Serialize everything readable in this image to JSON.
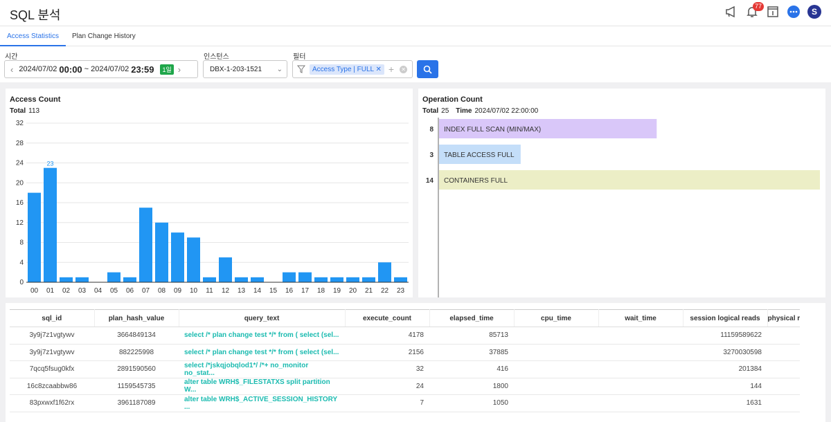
{
  "header": {
    "title": "SQL 분석",
    "notification_count": "77",
    "avatar_letter": "S",
    "icons": [
      "megaphone-icon",
      "bell-icon",
      "info-book-icon",
      "chat-icon",
      "avatar"
    ]
  },
  "tabs": [
    {
      "label": "Access Statistics",
      "active": true
    },
    {
      "label": "Plan Change History",
      "active": false
    }
  ],
  "filters": {
    "time_label": "시간",
    "start_date": "2024/07/02",
    "start_time": "00:00",
    "separator": "~",
    "end_date": "2024/07/02",
    "end_time": "23:59",
    "range_badge": "1일",
    "instance_label": "인스턴스",
    "instance_value": "DBX-1-203-1521",
    "filter_label": "필터",
    "filter_chip": "Access Type | FULL"
  },
  "access_panel": {
    "title": "Access Count",
    "total_label": "Total",
    "total_value": "113"
  },
  "operation_panel": {
    "title": "Operation Count",
    "total_label": "Total",
    "total_value": "25",
    "time_label": "Time",
    "time_value": "2024/07/02 22:00:00"
  },
  "chart_data": [
    {
      "type": "bar",
      "title": "Access Count",
      "categories": [
        "00",
        "01",
        "02",
        "03",
        "04",
        "05",
        "06",
        "07",
        "08",
        "09",
        "10",
        "11",
        "12",
        "13",
        "14",
        "15",
        "16",
        "17",
        "18",
        "19",
        "20",
        "21",
        "22",
        "23"
      ],
      "values": [
        18,
        23,
        1,
        1,
        0,
        2,
        1,
        15,
        12,
        10,
        9,
        1,
        5,
        1,
        1,
        0,
        2,
        2,
        1,
        1,
        1,
        1,
        4,
        1
      ],
      "ylim": [
        0,
        32
      ],
      "yticks": [
        0,
        4,
        8,
        12,
        16,
        20,
        24,
        28,
        32
      ],
      "highlight_label": {
        "category": "01",
        "value": "23"
      },
      "color": "#2196f3",
      "grid": true
    },
    {
      "type": "bar",
      "orientation": "horizontal",
      "title": "Operation Count",
      "categories": [
        "INDEX FULL SCAN (MIN/MAX)",
        "TABLE ACCESS FULL",
        "CONTAINERS FULL"
      ],
      "values": [
        8,
        3,
        14
      ],
      "colors": [
        "#d9c7f9",
        "#c4def9",
        "#eceec6"
      ]
    }
  ],
  "table": {
    "columns": [
      "sql_id",
      "plan_hash_value",
      "query_text",
      "execute_count",
      "elapsed_time",
      "cpu_time",
      "wait_time",
      "session logical reads",
      "physical r"
    ],
    "rows": [
      [
        "3y9j7z1vgtywv",
        "3664849134",
        "select /* plan change test */* from ( select (sel...",
        "4178",
        "85713",
        "",
        "",
        "11159589622",
        ""
      ],
      [
        "3y9j7z1vgtywv",
        "882225998",
        "select /* plan change test */* from ( select (sel...",
        "2156",
        "37885",
        "",
        "",
        "3270030598",
        ""
      ],
      [
        "7qcq5fsug0kfx",
        "2891590560",
        "select /*jskqjobqlod1*/ /*+ no_monitor no_stat...",
        "32",
        "416",
        "",
        "",
        "201384",
        ""
      ],
      [
        "16c8zcaabbw86",
        "1159545735",
        "alter table WRH$_FILESTATXS split partition W...",
        "24",
        "1800",
        "",
        "",
        "144",
        ""
      ],
      [
        "83pxwxf1f62rx",
        "3961187089",
        "alter table WRH$_ACTIVE_SESSION_HISTORY ...",
        "7",
        "1050",
        "",
        "",
        "1631",
        ""
      ]
    ]
  }
}
